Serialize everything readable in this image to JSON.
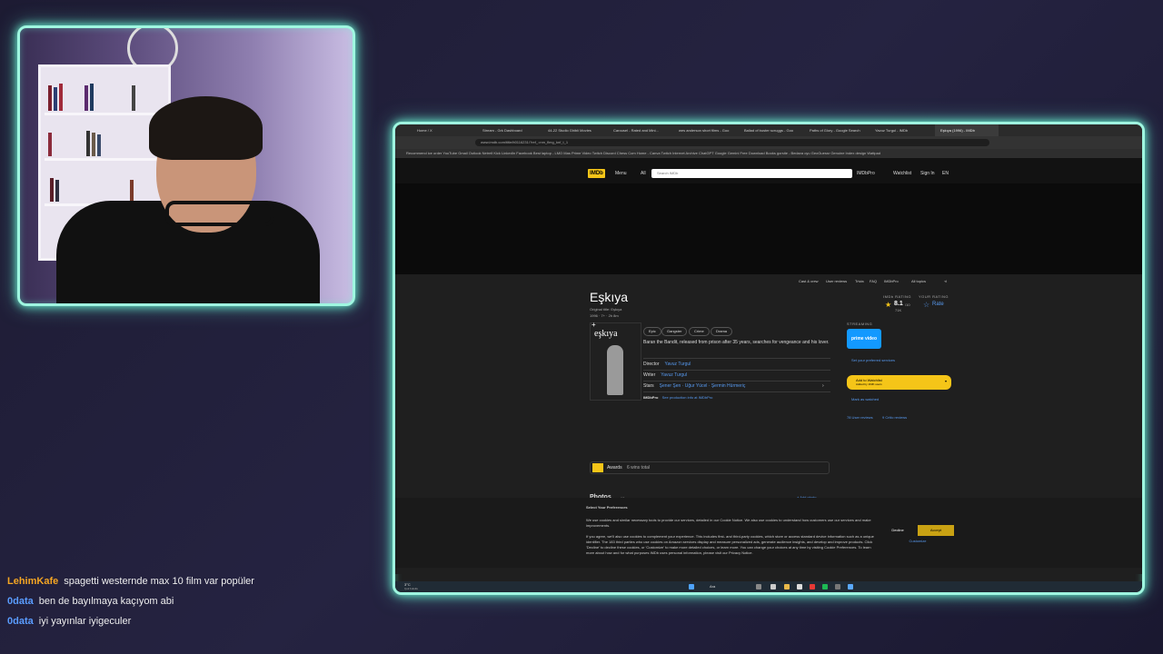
{
  "browser": {
    "tabs": [
      "Home / X",
      "Stream - Grk Dashboard",
      "44-22 Studio Ghibli Movies",
      "Carousel - Rated and Mini...",
      "wes anderson short films - Goo",
      "Ballad of buster scruggs - Goo",
      "Paths of Glory - Google Search",
      "Yavuz Turgul - IMDb",
      "Eşkıya (1996) - IMDb"
    ],
    "url": "www.imdb.com/title/tt0116231/?ref_=nm_flmg_knf_t_1",
    "bookmarks": "Recommend ice order   YouTube   Gmail   Outlook   Netrell   Kick   LinkedIn   Facebook   Best laptop - LMO Mas   Prime Video   Twitch   Discord   Chess Com   Home - Canva   Twitch   Internet Archive   ChatGPT   Google Gemini   Free Download Books   gorsite - Bedava oyu   GeoGuessr   Genuine Index design   Wattpad"
  },
  "imdb": {
    "logo": "IMDb",
    "menu": "Menu",
    "search_scope": "All",
    "search_placeholder": "Search IMDb",
    "imdbpro": "IMDbPro",
    "watchlist": "Watchlist",
    "sign_in": "Sign In",
    "lang": "EN",
    "subnav": [
      "Cast & crew",
      "User reviews",
      "Trivia",
      "FAQ",
      "IMDbPro",
      "All topics"
    ],
    "title": "Eşkıya",
    "original_title": "Original title: Eşkıya",
    "meta": "1996 · 7+ · 2h 8m",
    "rating_label": "IMDb RATING",
    "rating": "8.1",
    "rating_scale": "/10",
    "rating_count": "71K",
    "your_rating_label": "YOUR RATING",
    "rate": "Rate",
    "poster_title": "eşkıya",
    "genres": [
      "Epic",
      "Gangster",
      "Crime",
      "Drama"
    ],
    "plot": "Baran the Bandit, released from prison after 35 years, searches for vengeance and his lover.",
    "director_label": "Director",
    "director": "Yavuz Turgul",
    "writer_label": "Writer",
    "writer": "Yavuz Turgul",
    "stars_label": "Stars",
    "stars": "Şener Şen · Uğur Yücel · Şermin Hürmeriç",
    "pro_text": "See production info at IMDbPro",
    "streaming_label": "STREAMING",
    "prime": "prime video",
    "set_provider": "Set your preferred services",
    "watchlist_btn": "Add to Watchlist",
    "watchlist_sub": "Added by 163K users",
    "mark_watched": "Mark as watched",
    "user_reviews": "78 User reviews",
    "critic_reviews": "9 Critic reviews",
    "awards": "Awards",
    "awards_text": "6 wins total",
    "photos": "Photos",
    "photos_count": "10",
    "add_photo": "+ Add photo"
  },
  "cookie": {
    "heading": "Select Your Preferences",
    "p1": "We use cookies and similar necessary tools to provide our services, detailed in our Cookie Notice. We also use cookies to understand how customers use our services and make improvements.",
    "p2": "If you agree, we'll also use cookies to complement your experience. This includes first- and third-party cookies, which store or access standard device information such as a unique identifier. The 183 third parties who use cookies on Amazon services display and measure personalized ads, generate audience insights, and develop and improve products. Click 'Decline' to decline these cookies, or 'Customize' to make more detailed choices, or learn more. You can change your choices at any time by visiting Cookie Preferences. To learn more about how and for what purposes IMDb uses personal information, please visit our Privacy Notice.",
    "decline": "Decline",
    "accept": "Accept",
    "customize": "Customize"
  },
  "taskbar": {
    "temp": "3°C",
    "weather": "Çok bulutlu",
    "search": "Ara"
  },
  "chat": [
    {
      "user": "LehimKafe",
      "color": "#f5a623",
      "msg": "spagetti westernde max 10 film var popüler"
    },
    {
      "user": "0data",
      "color": "#5a9cff",
      "msg": "ben de bayılmaya kaçıyom abi"
    },
    {
      "user": "0data",
      "color": "#5a9cff",
      "msg": "iyi yayınlar iyigeculer"
    }
  ]
}
